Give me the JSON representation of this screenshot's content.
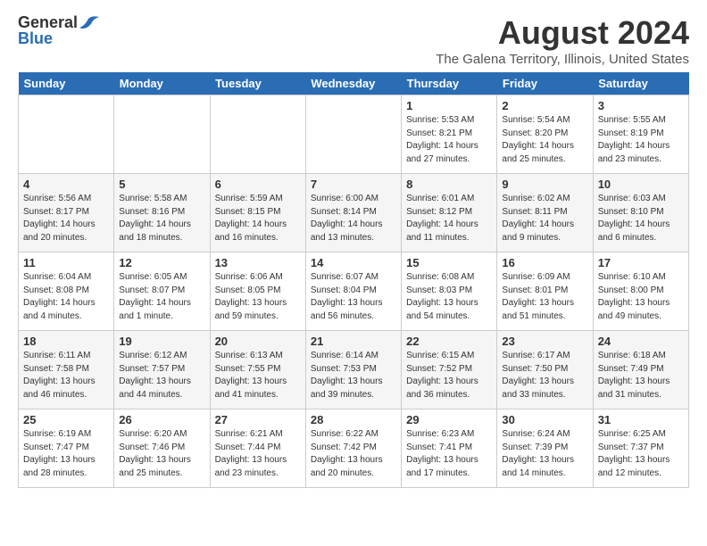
{
  "header": {
    "logo_general": "General",
    "logo_blue": "Blue",
    "month": "August 2024",
    "location": "The Galena Territory, Illinois, United States"
  },
  "weekdays": [
    "Sunday",
    "Monday",
    "Tuesday",
    "Wednesday",
    "Thursday",
    "Friday",
    "Saturday"
  ],
  "weeks": [
    [
      {
        "day": "",
        "info": ""
      },
      {
        "day": "",
        "info": ""
      },
      {
        "day": "",
        "info": ""
      },
      {
        "day": "",
        "info": ""
      },
      {
        "day": "1",
        "info": "Sunrise: 5:53 AM\nSunset: 8:21 PM\nDaylight: 14 hours\nand 27 minutes."
      },
      {
        "day": "2",
        "info": "Sunrise: 5:54 AM\nSunset: 8:20 PM\nDaylight: 14 hours\nand 25 minutes."
      },
      {
        "day": "3",
        "info": "Sunrise: 5:55 AM\nSunset: 8:19 PM\nDaylight: 14 hours\nand 23 minutes."
      }
    ],
    [
      {
        "day": "4",
        "info": "Sunrise: 5:56 AM\nSunset: 8:17 PM\nDaylight: 14 hours\nand 20 minutes."
      },
      {
        "day": "5",
        "info": "Sunrise: 5:58 AM\nSunset: 8:16 PM\nDaylight: 14 hours\nand 18 minutes."
      },
      {
        "day": "6",
        "info": "Sunrise: 5:59 AM\nSunset: 8:15 PM\nDaylight: 14 hours\nand 16 minutes."
      },
      {
        "day": "7",
        "info": "Sunrise: 6:00 AM\nSunset: 8:14 PM\nDaylight: 14 hours\nand 13 minutes."
      },
      {
        "day": "8",
        "info": "Sunrise: 6:01 AM\nSunset: 8:12 PM\nDaylight: 14 hours\nand 11 minutes."
      },
      {
        "day": "9",
        "info": "Sunrise: 6:02 AM\nSunset: 8:11 PM\nDaylight: 14 hours\nand 9 minutes."
      },
      {
        "day": "10",
        "info": "Sunrise: 6:03 AM\nSunset: 8:10 PM\nDaylight: 14 hours\nand 6 minutes."
      }
    ],
    [
      {
        "day": "11",
        "info": "Sunrise: 6:04 AM\nSunset: 8:08 PM\nDaylight: 14 hours\nand 4 minutes."
      },
      {
        "day": "12",
        "info": "Sunrise: 6:05 AM\nSunset: 8:07 PM\nDaylight: 14 hours\nand 1 minute."
      },
      {
        "day": "13",
        "info": "Sunrise: 6:06 AM\nSunset: 8:05 PM\nDaylight: 13 hours\nand 59 minutes."
      },
      {
        "day": "14",
        "info": "Sunrise: 6:07 AM\nSunset: 8:04 PM\nDaylight: 13 hours\nand 56 minutes."
      },
      {
        "day": "15",
        "info": "Sunrise: 6:08 AM\nSunset: 8:03 PM\nDaylight: 13 hours\nand 54 minutes."
      },
      {
        "day": "16",
        "info": "Sunrise: 6:09 AM\nSunset: 8:01 PM\nDaylight: 13 hours\nand 51 minutes."
      },
      {
        "day": "17",
        "info": "Sunrise: 6:10 AM\nSunset: 8:00 PM\nDaylight: 13 hours\nand 49 minutes."
      }
    ],
    [
      {
        "day": "18",
        "info": "Sunrise: 6:11 AM\nSunset: 7:58 PM\nDaylight: 13 hours\nand 46 minutes."
      },
      {
        "day": "19",
        "info": "Sunrise: 6:12 AM\nSunset: 7:57 PM\nDaylight: 13 hours\nand 44 minutes."
      },
      {
        "day": "20",
        "info": "Sunrise: 6:13 AM\nSunset: 7:55 PM\nDaylight: 13 hours\nand 41 minutes."
      },
      {
        "day": "21",
        "info": "Sunrise: 6:14 AM\nSunset: 7:53 PM\nDaylight: 13 hours\nand 39 minutes."
      },
      {
        "day": "22",
        "info": "Sunrise: 6:15 AM\nSunset: 7:52 PM\nDaylight: 13 hours\nand 36 minutes."
      },
      {
        "day": "23",
        "info": "Sunrise: 6:17 AM\nSunset: 7:50 PM\nDaylight: 13 hours\nand 33 minutes."
      },
      {
        "day": "24",
        "info": "Sunrise: 6:18 AM\nSunset: 7:49 PM\nDaylight: 13 hours\nand 31 minutes."
      }
    ],
    [
      {
        "day": "25",
        "info": "Sunrise: 6:19 AM\nSunset: 7:47 PM\nDaylight: 13 hours\nand 28 minutes."
      },
      {
        "day": "26",
        "info": "Sunrise: 6:20 AM\nSunset: 7:46 PM\nDaylight: 13 hours\nand 25 minutes."
      },
      {
        "day": "27",
        "info": "Sunrise: 6:21 AM\nSunset: 7:44 PM\nDaylight: 13 hours\nand 23 minutes."
      },
      {
        "day": "28",
        "info": "Sunrise: 6:22 AM\nSunset: 7:42 PM\nDaylight: 13 hours\nand 20 minutes."
      },
      {
        "day": "29",
        "info": "Sunrise: 6:23 AM\nSunset: 7:41 PM\nDaylight: 13 hours\nand 17 minutes."
      },
      {
        "day": "30",
        "info": "Sunrise: 6:24 AM\nSunset: 7:39 PM\nDaylight: 13 hours\nand 14 minutes."
      },
      {
        "day": "31",
        "info": "Sunrise: 6:25 AM\nSunset: 7:37 PM\nDaylight: 13 hours\nand 12 minutes."
      }
    ]
  ]
}
